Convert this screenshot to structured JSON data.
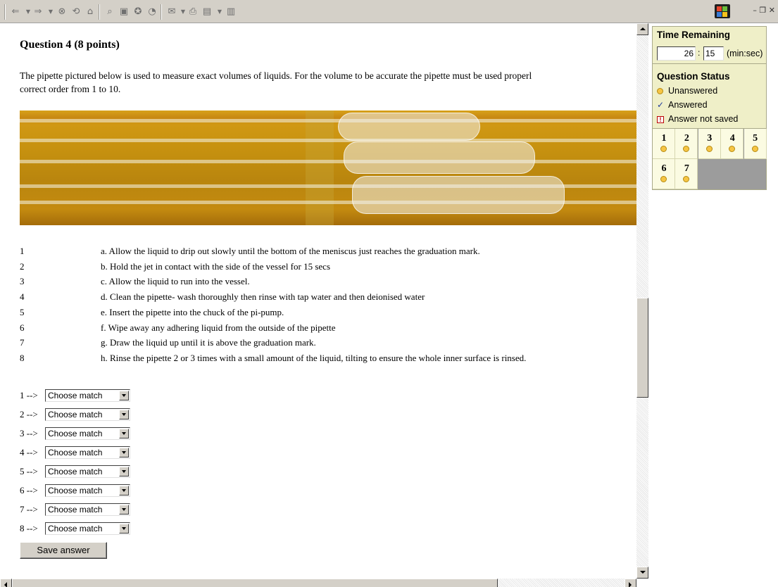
{
  "question": {
    "title": "Question 4  (8 points)",
    "text": "The pipette pictured below is used to measure exact volumes of liquids. For the volume to be accurate the pipette must be used properl\ncorrect order from 1 to 10."
  },
  "steps": [
    {
      "num": "1",
      "text": "a. Allow the liquid to drip out slowly until the bottom of the meniscus just reaches the graduation mark."
    },
    {
      "num": "2",
      "text": "b. Hold the jet in contact with the side of the vessel for 15 secs"
    },
    {
      "num": "3",
      "text": "c. Allow the liquid to run into the vessel."
    },
    {
      "num": "4",
      "text": "d. Clean the pipette- wash thoroughly then rinse with tap water and then deionised water"
    },
    {
      "num": "5",
      "text": "e. Insert the pipette into the chuck of the pi-pump."
    },
    {
      "num": "6",
      "text": "f. Wipe away any adhering liquid from the outside of the pipette"
    },
    {
      "num": "7",
      "text": "g. Draw the liquid up until it is above the graduation mark."
    },
    {
      "num": "8",
      "text": "h. Rinse the pipette 2 or 3 times with a small amount of the liquid, tilting to ensure the whole inner surface is rinsed."
    }
  ],
  "matches": [
    {
      "label": "1 -->",
      "value": "Choose match"
    },
    {
      "label": "2 -->",
      "value": "Choose match"
    },
    {
      "label": "3 -->",
      "value": "Choose match"
    },
    {
      "label": "4 -->",
      "value": "Choose match"
    },
    {
      "label": "5 -->",
      "value": "Choose match"
    },
    {
      "label": "6 -->",
      "value": "Choose match"
    },
    {
      "label": "7 -->",
      "value": "Choose match"
    },
    {
      "label": "8 -->",
      "value": "Choose match"
    }
  ],
  "save_label": "Save answer",
  "timer": {
    "heading": "Time Remaining",
    "minutes": "26",
    "separator": ":",
    "seconds": "15",
    "unit": "(min:sec)"
  },
  "status": {
    "heading": "Question Status",
    "legend": [
      {
        "icon": "unanswered-icon",
        "label": "Unanswered"
      },
      {
        "icon": "answered-check-icon",
        "label": "Answered"
      },
      {
        "icon": "not-saved-icon",
        "label": "Answer not saved"
      }
    ]
  },
  "question_nav": [
    "1",
    "2",
    "3",
    "4",
    "5",
    "6",
    "7"
  ],
  "colors": {
    "panel_bg": "#efefc8",
    "unanswered_dot": "#f6c544",
    "toolbar_bg": "#d4d0c8"
  },
  "toolbar_icons": [
    "back-arrow-icon",
    "dropdown-icon",
    "forward-arrow-icon",
    "dropdown-icon",
    "stop-icon",
    "refresh-icon",
    "home-icon",
    "search-icon",
    "favorites-icon",
    "media-icon",
    "history-icon",
    "mail-icon",
    "print-icon",
    "edit-icon",
    "discuss-icon"
  ]
}
